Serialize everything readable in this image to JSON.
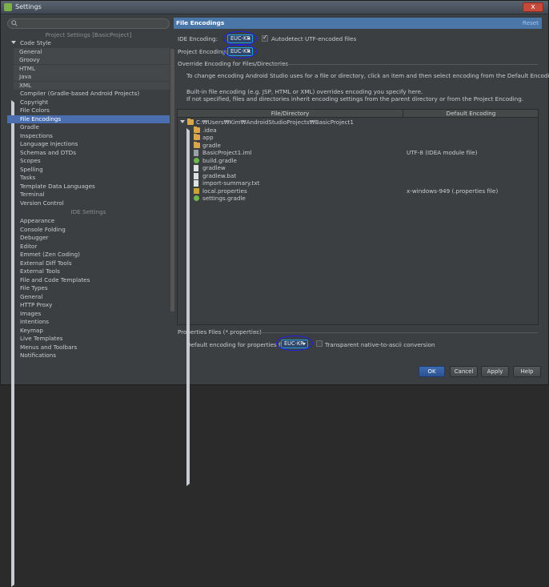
{
  "window": {
    "title": "Settings",
    "close_label": "x"
  },
  "search": {
    "placeholder": ""
  },
  "sidebar": {
    "project_section": "Project Settings [BasicProject]",
    "ide_section": "IDE Settings",
    "items": [
      {
        "label": "Code Style",
        "indent": 0,
        "arrow": "down"
      },
      {
        "label": "General",
        "indent": 2,
        "arrow": ""
      },
      {
        "label": "Groovy",
        "indent": 2,
        "arrow": ""
      },
      {
        "label": "HTML",
        "indent": 2,
        "arrow": ""
      },
      {
        "label": "Java",
        "indent": 2,
        "arrow": ""
      },
      {
        "label": "XML",
        "indent": 2,
        "arrow": ""
      },
      {
        "label": "Compiler (Gradle-based Android Projects)",
        "indent": 0,
        "arrow": ""
      },
      {
        "label": "Copyright",
        "indent": 0,
        "arrow": "right"
      },
      {
        "label": "File Colors",
        "indent": 0,
        "arrow": ""
      },
      {
        "label": "File Encodings",
        "indent": 0,
        "arrow": "",
        "selected": true
      },
      {
        "label": "Gradle",
        "indent": 0,
        "arrow": "right"
      },
      {
        "label": "Inspections",
        "indent": 0,
        "arrow": ""
      },
      {
        "label": "Language Injections",
        "indent": 0,
        "arrow": "right"
      },
      {
        "label": "Schemas and DTDs",
        "indent": 0,
        "arrow": "right"
      },
      {
        "label": "Scopes",
        "indent": 0,
        "arrow": ""
      },
      {
        "label": "Spelling",
        "indent": 0,
        "arrow": ""
      },
      {
        "label": "Tasks",
        "indent": 0,
        "arrow": "right"
      },
      {
        "label": "Template Data Languages",
        "indent": 0,
        "arrow": ""
      },
      {
        "label": "Terminal",
        "indent": 0,
        "arrow": ""
      },
      {
        "label": "Version Control",
        "indent": 0,
        "arrow": "right"
      }
    ],
    "ide_items": [
      {
        "label": "Appearance",
        "arrow": ""
      },
      {
        "label": "Console Folding",
        "arrow": ""
      },
      {
        "label": "Debugger",
        "arrow": "right"
      },
      {
        "label": "Editor",
        "arrow": "right"
      },
      {
        "label": "Emmet (Zen Coding)",
        "arrow": ""
      },
      {
        "label": "External Diff Tools",
        "arrow": ""
      },
      {
        "label": "External Tools",
        "arrow": ""
      },
      {
        "label": "File and Code Templates",
        "arrow": ""
      },
      {
        "label": "File Types",
        "arrow": ""
      },
      {
        "label": "General",
        "arrow": ""
      },
      {
        "label": "HTTP Proxy",
        "arrow": ""
      },
      {
        "label": "Images",
        "arrow": ""
      },
      {
        "label": "Intentions",
        "arrow": ""
      },
      {
        "label": "Keymap",
        "arrow": ""
      },
      {
        "label": "Live Templates",
        "arrow": ""
      },
      {
        "label": "Menus and Toolbars",
        "arrow": ""
      },
      {
        "label": "Notifications",
        "arrow": ""
      }
    ]
  },
  "panel": {
    "title": "File Encodings",
    "reset": "Reset",
    "ide_encoding_label": "IDE Encoding:",
    "ide_encoding_value": "EUC-KR",
    "autodetect_label": "Autodetect UTF-encoded files",
    "project_encoding_label": "Project Encoding:",
    "project_encoding_value": "EUC-KR",
    "override_group": "Override Encoding for Files/Directories",
    "info1": "To change encoding Android Studio uses for a file or directory, click an item and then select encoding from the Default Encoding list.",
    "info2": "Built-in file encoding (e.g. JSP, HTML or XML) overrides encoding you specify here.",
    "info3": "If not specified, files and directories inherit encoding settings from the parent directory or from the Project Encoding.",
    "col_file": "File/Directory",
    "col_encoding": "Default Encoding",
    "rows": [
      {
        "name": "C:₩Users₩Kim₩AndroidStudioProjects₩BasicProject1",
        "icon": "folder-icon",
        "arrow": "down",
        "encoding": ""
      },
      {
        "name": ".idea",
        "icon": "folder-icon",
        "arrow": "right",
        "encoding": ""
      },
      {
        "name": "app",
        "icon": "folder-icon",
        "arrow": "right",
        "encoding": ""
      },
      {
        "name": "gradle",
        "icon": "folder-icon",
        "arrow": "right",
        "encoding": ""
      },
      {
        "name": "BasicProject1.iml",
        "icon": "iml-file-icon",
        "arrow": "",
        "encoding": "UTF-8 (IDEA module file)"
      },
      {
        "name": "build.gradle",
        "icon": "gradle-file-icon",
        "arrow": "",
        "encoding": ""
      },
      {
        "name": "gradlew",
        "icon": "text-file-icon",
        "arrow": "",
        "encoding": ""
      },
      {
        "name": "gradlew.bat",
        "icon": "text-file-icon",
        "arrow": "",
        "encoding": ""
      },
      {
        "name": "import-summary.txt",
        "icon": "text-file-icon",
        "arrow": "",
        "encoding": ""
      },
      {
        "name": "local.properties",
        "icon": "properties-file-icon",
        "arrow": "",
        "encoding": "x-windows-949 (.properties file)"
      },
      {
        "name": "settings.gradle",
        "icon": "gradle-file-icon",
        "arrow": "",
        "encoding": ""
      }
    ],
    "properties_group": "Properties Files (*.properties)",
    "properties_default_label": "Default encoding for properties files:",
    "properties_value": "EUC-KR",
    "native_ascii_label": "Transparent native-to-ascii conversion"
  },
  "buttons": {
    "ok": "OK",
    "cancel": "Cancel",
    "apply": "Apply",
    "help": "Help"
  },
  "colors": {
    "accent": "#4b6eaf",
    "highlight_oval": "#1f1ff0",
    "header": "#4a77a8"
  }
}
